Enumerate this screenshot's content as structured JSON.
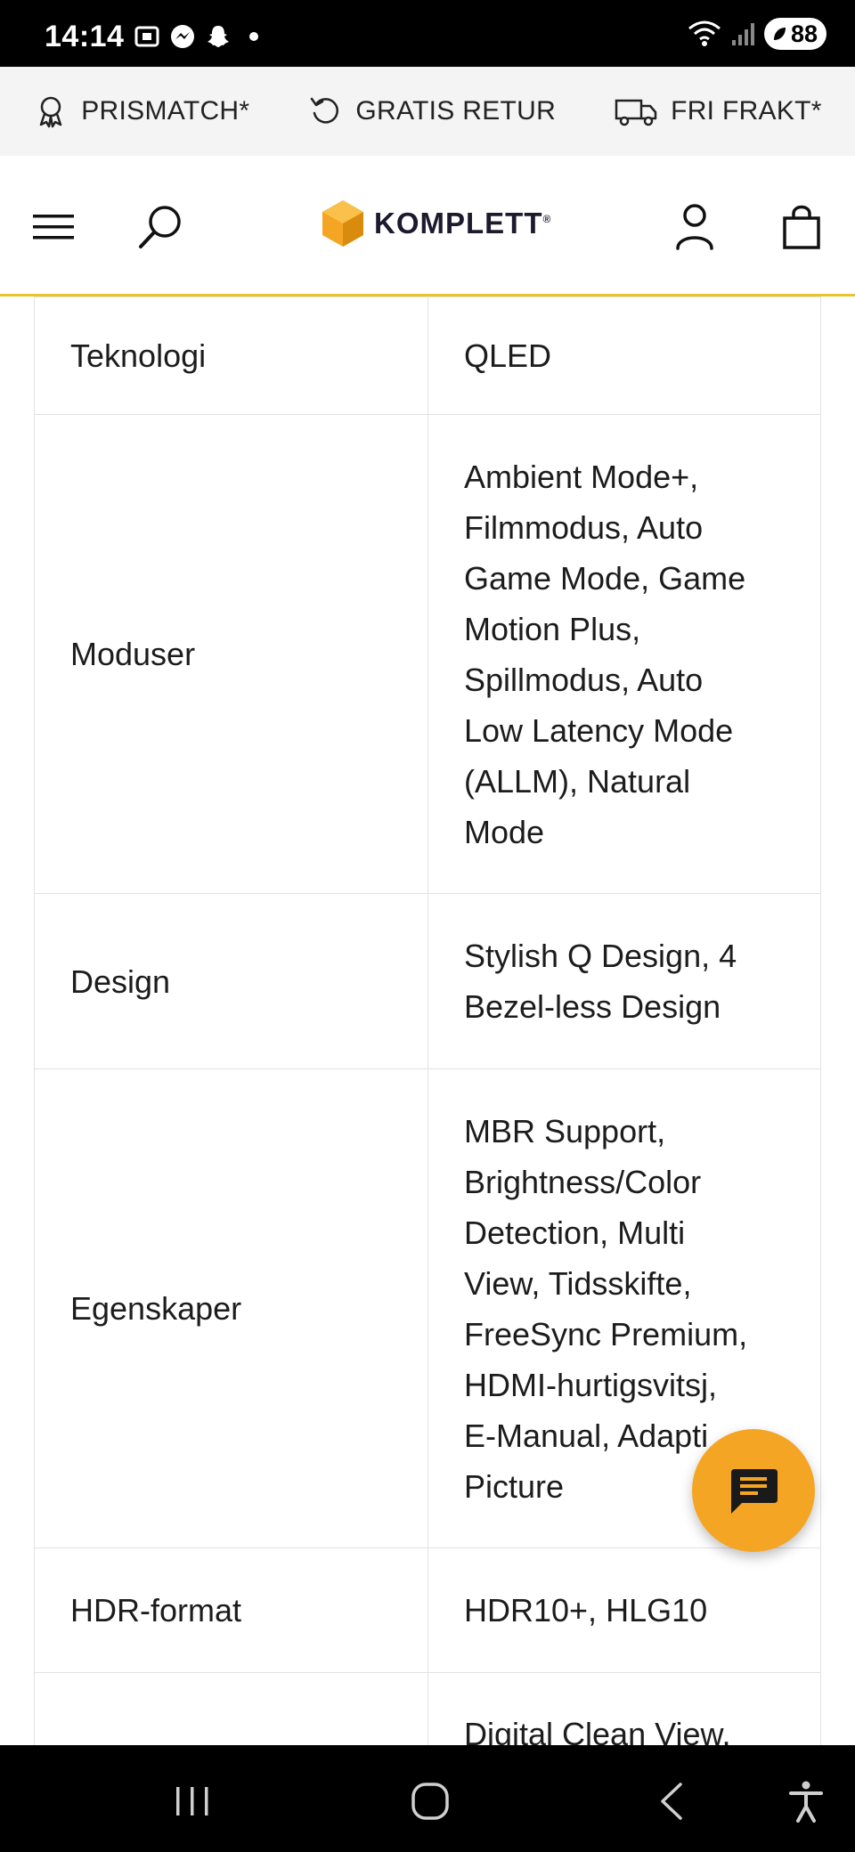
{
  "status_bar": {
    "time": "14:14",
    "battery": "88"
  },
  "promo_bar": {
    "items": [
      {
        "label": "PRISMATCH*",
        "icon": "award-icon"
      },
      {
        "label": "GRATIS RETUR",
        "icon": "return-icon"
      },
      {
        "label": "FRI FRAKT*",
        "icon": "truck-icon"
      }
    ]
  },
  "header": {
    "logo_text": "KOMPLETT",
    "brand_color": "#f5a524",
    "accent_line_color": "#e8c62b"
  },
  "specs": {
    "rows": [
      {
        "label": "Teknologi",
        "value": "QLED"
      },
      {
        "label": "Moduser",
        "value_lines": [
          "Ambient Mode+,",
          "Filmmodus, Auto",
          "Game Mode, Game",
          "Motion Plus,",
          "Spillmodus, Auto",
          "Low Latency Mode",
          "(ALLM), Natural",
          "Mode"
        ]
      },
      {
        "label": "Design",
        "value_lines": [
          "Stylish Q Design, 4",
          "Bezel-less Design"
        ]
      },
      {
        "label": "Egenskaper",
        "value_lines": [
          "MBR Support,",
          "Brightness/Color",
          "Detection, Multi",
          "View, Tidsskifte,",
          "FreeSync Premium,",
          "HDMI-hurtigsvitsj,",
          "E-Manual, Adapti",
          "Picture"
        ]
      },
      {
        "label": "HDR-format",
        "value": "HDR10+, HLG10"
      },
      {
        "label": "",
        "value": "Digital Clean View,"
      }
    ]
  },
  "chat": {
    "icon": "chat-icon"
  }
}
